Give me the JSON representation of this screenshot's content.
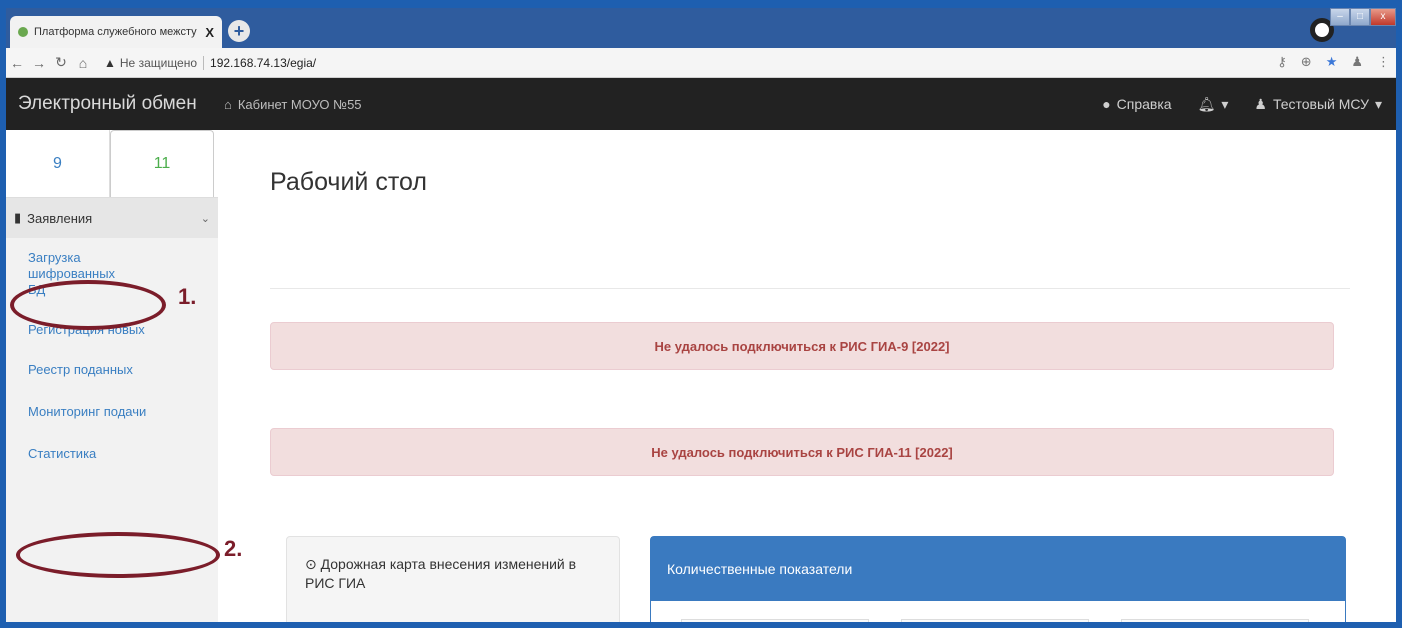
{
  "browser": {
    "tab_title": "Платформа служебного межсту",
    "tab_close": "X",
    "new_tab": "+",
    "security_label": "Не защищено",
    "url": "192.168.74.13/egia/"
  },
  "navbar": {
    "brand": "Электронный обмен",
    "cabinet": "Кабинет МОУО №55",
    "help": "Справка",
    "user": "Тестовый МСУ"
  },
  "sidebar": {
    "tab_9": "9",
    "tab_11": "11",
    "section_title": "Заявления",
    "items": [
      {
        "label": "Загрузка шифрованных БД"
      },
      {
        "label": "Регистрация новых"
      },
      {
        "label": "Реестр поданных"
      },
      {
        "label": "Мониторинг подачи"
      },
      {
        "label": "Статистика"
      }
    ]
  },
  "annotations": {
    "mark_1": "1.",
    "mark_2": "2."
  },
  "main": {
    "title": "Рабочий стол",
    "alerts": [
      {
        "text": "Не удалось подключиться к РИС ГИА-9 [2022]"
      },
      {
        "text": "Не удалось подключиться к РИС ГИА-11 [2022]"
      }
    ],
    "roadmap_title": "Дорожная карта внесения изменений в РИС ГИА",
    "stats_title": "Количественные показатели"
  },
  "colors": {
    "frame": "#1e5fb0",
    "navbar": "#222222",
    "link": "#3a7fc2",
    "alert_bg": "#f2dede",
    "alert_text": "#a94442",
    "panel_primary": "#3a7ac0",
    "annotation": "#7b1d2a"
  }
}
